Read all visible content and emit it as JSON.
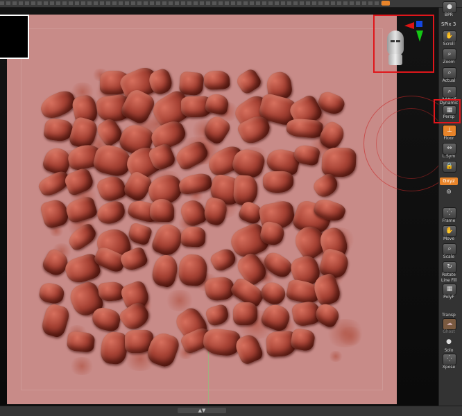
{
  "toolbar": {
    "bpr_label": "BPR",
    "spix_label": "SPix",
    "spix_value": "3",
    "scroll_label": "Scroll",
    "zoom_label": "Zoom",
    "actual_label": "Actual",
    "aahalf_label": "AAHalf",
    "dynamic_label": "Dynamic",
    "persp_label": "Persp",
    "floor_label": "Floor",
    "lsym_label": "L.Sym",
    "gxyz_label": "Gxyz",
    "frame_label": "Frame",
    "move_label": "Move",
    "zoom3d_label": "Scale",
    "rotate_label": "Rotate",
    "line_fill_label": "Line Fill",
    "polyf_label": "PolyF",
    "transp_label": "Transp",
    "ghost_label": "Ghost",
    "solo_label": "Solo",
    "xpose_label": "Xpose"
  },
  "colors": {
    "accent": "#e8842a",
    "highlight_box": "#e0161b",
    "canvas_clay": "#c88b88",
    "stone_dark": "#6a1e16",
    "axis_red": "#e01414",
    "axis_green": "#14c814",
    "axis_blue": "#1446e0"
  },
  "icons": {
    "gizmo": "head-orientation-icon",
    "persp": "perspective-grid-icon"
  }
}
